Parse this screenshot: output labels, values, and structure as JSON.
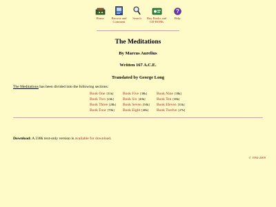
{
  "nav": {
    "home": "Home",
    "browse_line1": "Browse and",
    "browse_line2": "Comment",
    "search": "Search",
    "buy_line1": "Buy Books and",
    "buy_line2": "CD-ROMs",
    "help": "Help",
    "icons": [
      "home-icon",
      "browse-comment-icon",
      "search-icon",
      "buy-books-icon",
      "help-icon"
    ]
  },
  "title": "The Meditations",
  "author": "By Marcus Aurelius",
  "written": "Written 167 A.C.E.",
  "translated": "Translated by George Long",
  "intro": {
    "link": "The Meditations",
    "text": " has been divided into the following sections:"
  },
  "sections": [
    {
      "label": "Book One",
      "size": "[31k]"
    },
    {
      "label": "Book Five",
      "size": "[38k]"
    },
    {
      "label": "Book Nine",
      "size": "[38k]"
    },
    {
      "label": "Book Two",
      "size": "[24k]"
    },
    {
      "label": "Book Six",
      "size": "[40k]"
    },
    {
      "label": "Book Ten",
      "size": "[38k]"
    },
    {
      "label": "Book Three",
      "size": "[28k]"
    },
    {
      "label": "Book Seven",
      "size": "[50k]"
    },
    {
      "label": "Book Eleven",
      "size": "[33k]"
    },
    {
      "label": "Book Four",
      "size": "[70k]"
    },
    {
      "label": "Book Eight",
      "size": "[40k]"
    },
    {
      "label": "Book Twelve",
      "size": "[27k]"
    }
  ],
  "download": {
    "label": "Download:",
    "text": " A 238k text-only version is ",
    "link": "available for download",
    "end": "."
  },
  "copyright": "© 1994-2009",
  "colors": {
    "background": "#fffbc9",
    "link": "#9b1c1c",
    "rule": "#c9a3a0"
  }
}
